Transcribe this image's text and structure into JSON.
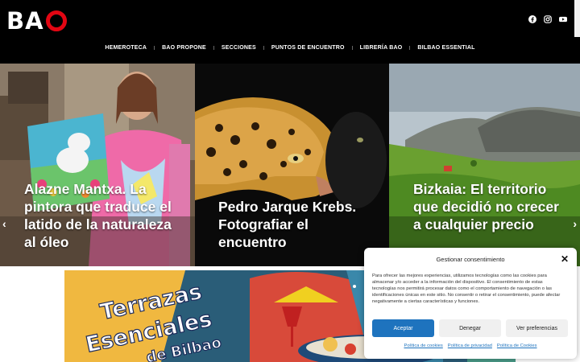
{
  "brand": {
    "logo_text": "BA",
    "accent_color": "#e30613"
  },
  "social": [
    "facebook-icon",
    "instagram-icon",
    "youtube-icon"
  ],
  "nav": {
    "items": [
      "HEMEROTECA",
      "BAO PROPONE",
      "SECCIONES",
      "PUNTOS DE ENCUENTRO",
      "LIBRERÍA BAO",
      "BILBAO ESSENTIAL"
    ]
  },
  "slider": {
    "prev_arrow": "‹",
    "next_arrow": "›",
    "slides": [
      {
        "title": "Alazne Mantxa. La pintora que traduce el latido de la naturaleza al óleo"
      },
      {
        "title": "Pedro Jarque Krebs. Fotografiar el encuentro"
      },
      {
        "title": "Bizkaia: El territorio que decidió no crecer a cualquier precio"
      }
    ]
  },
  "banner": {
    "line1": "Terrazas",
    "line2": "Esenciales",
    "line3": "de Bilbao"
  },
  "cookie": {
    "title": "Gestionar consentimiento",
    "close": "✕",
    "body": "Para ofrecer las mejores experiencias, utilizamos tecnologías como las cookies para almacenar y/o acceder a la información del dispositivo. El consentimiento de estas tecnologías nos permitirá procesar datos como el comportamiento de navegación o las identificaciones únicas en este sitio. No consentir o retirar el consentimiento, puede afectar negativamente a ciertas características y funciones.",
    "accept": "Aceptar",
    "deny": "Denegar",
    "preferences": "Ver preferencias",
    "links": [
      "Política de cookies",
      "Política de privacidad",
      "Política de Cookies"
    ]
  }
}
